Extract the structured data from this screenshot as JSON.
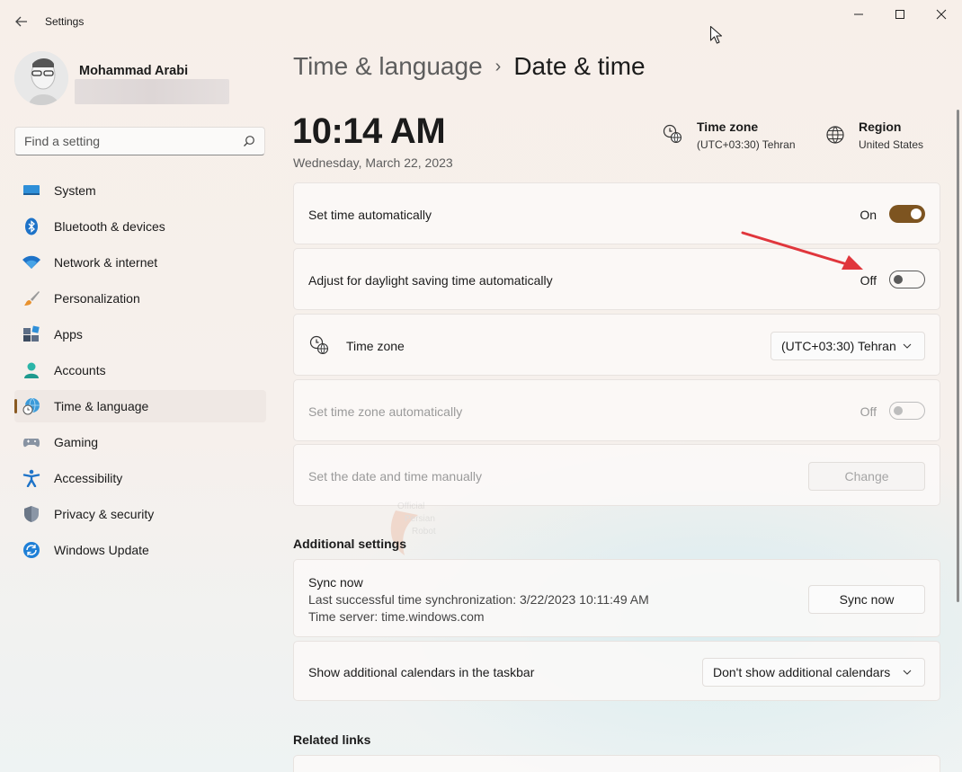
{
  "window": {
    "title": "Settings"
  },
  "profile": {
    "name": "Mohammad Arabi"
  },
  "search": {
    "placeholder": "Find a setting"
  },
  "sidebar": {
    "items": [
      {
        "label": "System",
        "icon": "monitor-icon"
      },
      {
        "label": "Bluetooth & devices",
        "icon": "bluetooth-icon"
      },
      {
        "label": "Network & internet",
        "icon": "wifi-icon"
      },
      {
        "label": "Personalization",
        "icon": "brush-icon"
      },
      {
        "label": "Apps",
        "icon": "apps-icon"
      },
      {
        "label": "Accounts",
        "icon": "person-icon"
      },
      {
        "label": "Time & language",
        "icon": "globe-clock-icon",
        "active": true
      },
      {
        "label": "Gaming",
        "icon": "gamepad-icon"
      },
      {
        "label": "Accessibility",
        "icon": "accessibility-icon"
      },
      {
        "label": "Privacy & security",
        "icon": "shield-icon"
      },
      {
        "label": "Windows Update",
        "icon": "update-icon"
      }
    ]
  },
  "header": {
    "parent": "Time & language",
    "separator": "›",
    "current": "Date & time"
  },
  "clock": {
    "time": "10:14 AM",
    "date": "Wednesday, March 22, 2023"
  },
  "info": {
    "timezone_title": "Time zone",
    "timezone_value": "(UTC+03:30) Tehran",
    "region_title": "Region",
    "region_value": "United States"
  },
  "settings": {
    "set_time_auto": {
      "label": "Set time automatically",
      "state": "On"
    },
    "daylight_saving": {
      "label": "Adjust for daylight saving time automatically",
      "state": "Off"
    },
    "time_zone": {
      "label": "Time zone",
      "value": "(UTC+03:30) Tehran"
    },
    "set_tz_auto": {
      "label": "Set time zone automatically",
      "state": "Off"
    },
    "manual": {
      "label": "Set the date and time manually",
      "button": "Change"
    }
  },
  "additional": {
    "title": "Additional settings",
    "sync": {
      "title": "Sync now",
      "last_sync": "Last successful time synchronization: 3/22/2023 10:11:49 AM",
      "server": "Time server: time.windows.com",
      "button": "Sync now"
    },
    "calendars": {
      "label": "Show additional calendars in the taskbar",
      "value": "Don't show additional calendars"
    }
  },
  "related": {
    "title": "Related links"
  },
  "colors": {
    "accent": "#7d5420",
    "arrow": "#e0363c"
  }
}
